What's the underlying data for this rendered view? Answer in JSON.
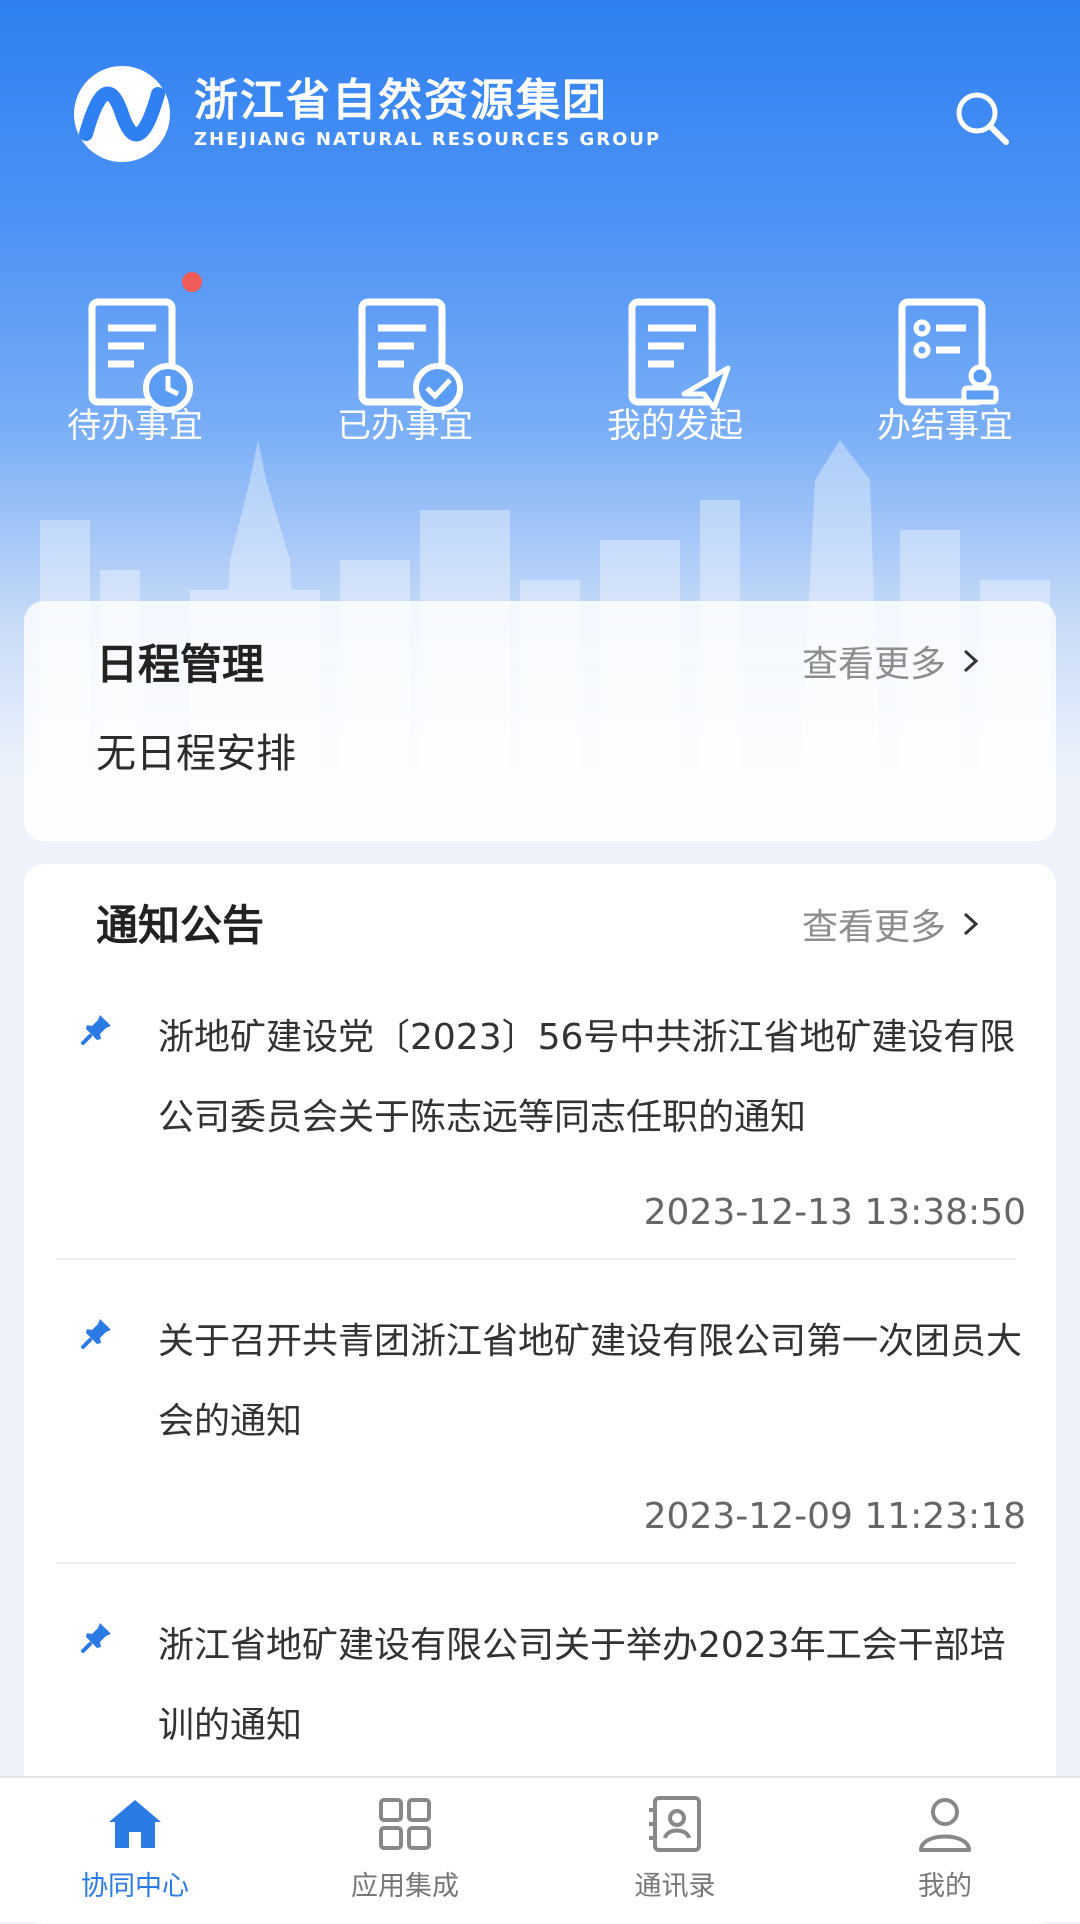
{
  "header": {
    "brand_cn": "浙江省自然资源集团",
    "brand_en": "ZHEJIANG NATURAL RESOURCES GROUP",
    "search_icon": "search-icon"
  },
  "quick_actions": [
    {
      "label": "待办事宜",
      "icon": "pending-doc-clock-icon",
      "has_badge": true
    },
    {
      "label": "已办事宜",
      "icon": "done-doc-check-icon"
    },
    {
      "label": "我的发起",
      "icon": "initiated-doc-send-icon"
    },
    {
      "label": "办结事宜",
      "icon": "closed-doc-stamp-icon"
    }
  ],
  "schedule": {
    "title": "日程管理",
    "more": "查看更多",
    "empty": "无日程安排"
  },
  "notices": {
    "title": "通知公告",
    "more": "查看更多",
    "items": [
      {
        "title": "浙地矿建设党〔2023〕56号中共浙江省地矿建设有限公司委员会关于陈志远等同志任职的通知",
        "time": "2023-12-13 13:38:50"
      },
      {
        "title": "关于召开共青团浙江省地矿建设有限公司第一次团员大会的通知",
        "time": "2023-12-09 11:23:18"
      },
      {
        "title": "浙江省地矿建设有限公司关于举办2023年工会干部培训的通知",
        "time": ""
      }
    ]
  },
  "tabbar": [
    {
      "label": "协同中心",
      "icon": "home-icon",
      "active": true
    },
    {
      "label": "应用集成",
      "icon": "apps-grid-icon"
    },
    {
      "label": "通讯录",
      "icon": "contacts-icon"
    },
    {
      "label": "我的",
      "icon": "user-icon"
    }
  ],
  "colors": {
    "primary": "#2b7be5",
    "badge": "#f15a57",
    "pin": "#2b7be5"
  }
}
